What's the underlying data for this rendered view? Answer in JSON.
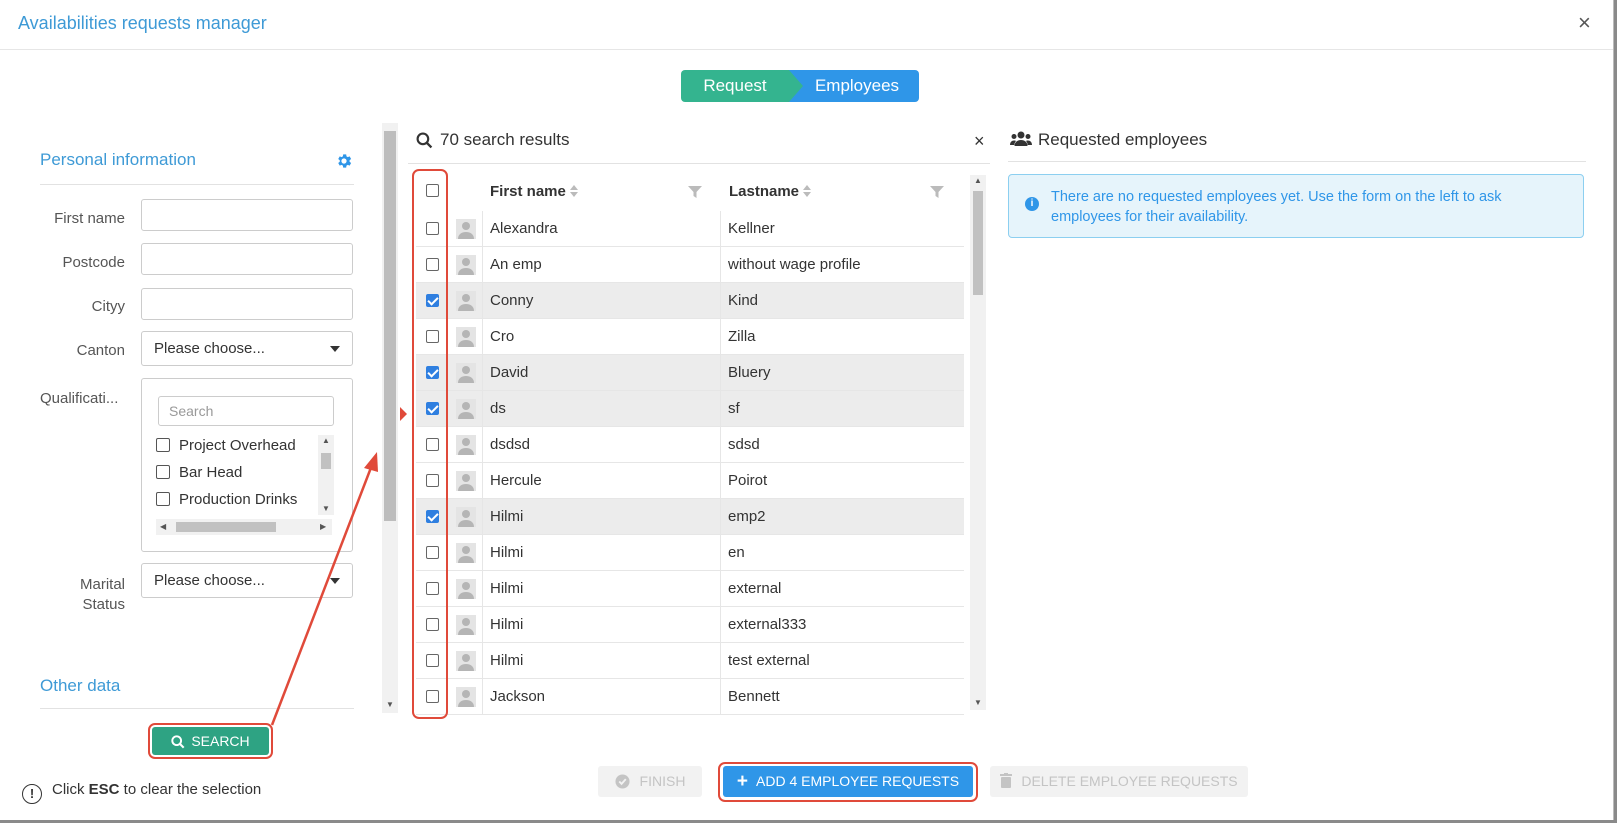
{
  "dialog": {
    "title": "Availabilities requests manager",
    "close": "×"
  },
  "steps": [
    "Request",
    "Employees"
  ],
  "personal": {
    "title": "Personal information",
    "fields": [
      {
        "label": "First name",
        "value": ""
      },
      {
        "label": "Postcode",
        "value": ""
      },
      {
        "label": "Cityy",
        "value": ""
      }
    ],
    "canton": {
      "label": "Canton",
      "value": "Please choose..."
    },
    "qualifications": {
      "label": "Qualificati...",
      "search_placeholder": "Search",
      "items": [
        "Project Overhead",
        "Bar Head",
        "Production Drinks"
      ]
    },
    "marital": {
      "label_1": "Marital",
      "label_2": "Status",
      "value": "Please choose..."
    }
  },
  "other": {
    "title": "Other data"
  },
  "search_button": "SEARCH",
  "hint": {
    "prefix": "Click ",
    "key": "ESC",
    "suffix": " to clear the selection"
  },
  "results": {
    "heading": "70 search results",
    "close": "×",
    "columns": [
      "First name",
      "Lastname"
    ],
    "rows": [
      {
        "first": "Alexandra",
        "last": "Kellner",
        "checked": false
      },
      {
        "first": "An emp",
        "last": "without wage profile",
        "checked": false
      },
      {
        "first": "Conny",
        "last": "Kind",
        "checked": true
      },
      {
        "first": "Cro",
        "last": "Zilla",
        "checked": false
      },
      {
        "first": "David",
        "last": "Bluery",
        "checked": true
      },
      {
        "first": "ds",
        "last": "sf",
        "checked": true
      },
      {
        "first": "dsdsd",
        "last": "sdsd",
        "checked": false
      },
      {
        "first": "Hercule",
        "last": "Poirot",
        "checked": false
      },
      {
        "first": "Hilmi",
        "last": "emp2",
        "checked": true
      },
      {
        "first": "Hilmi",
        "last": "en",
        "checked": false
      },
      {
        "first": "Hilmi",
        "last": "external",
        "checked": false
      },
      {
        "first": "Hilmi",
        "last": "external333",
        "checked": false
      },
      {
        "first": "Hilmi",
        "last": "test external",
        "checked": false
      },
      {
        "first": "Jackson",
        "last": "Bennett",
        "checked": false
      }
    ]
  },
  "requested": {
    "heading": "Requested employees",
    "info": "There are no requested employees yet. Use the form on the left to ask employees for their availability."
  },
  "buttons": {
    "finish": "FINISH",
    "add": "ADD 4 EMPLOYEE REQUESTS",
    "delete": "DELETE EMPLOYEE REQUESTS"
  },
  "colors": {
    "accent": "#2f96e8",
    "step_done": "#34b48f",
    "search_btn": "#2ea383",
    "annotation": "#e04a3a"
  }
}
